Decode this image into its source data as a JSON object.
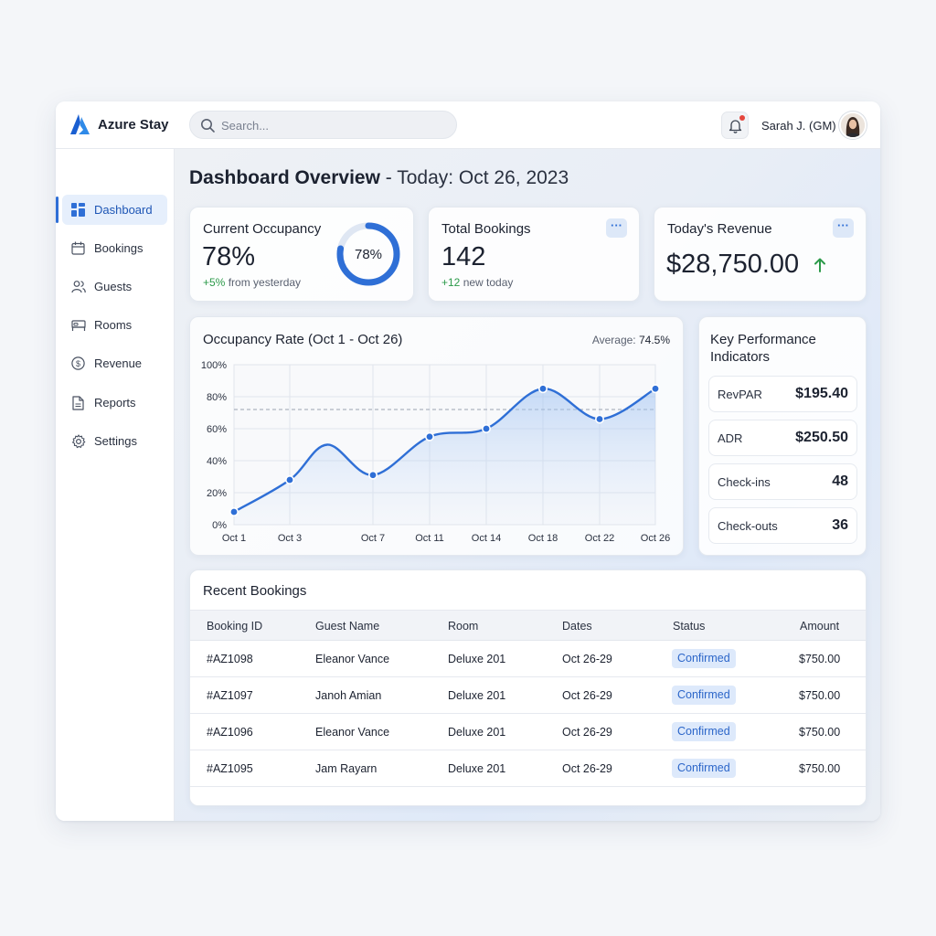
{
  "app": {
    "name": "Azure Stay"
  },
  "search": {
    "placeholder": "Search..."
  },
  "user": {
    "name": "Sarah J. (GM)"
  },
  "sidebar": {
    "items": [
      {
        "label": "Dashboard",
        "icon": "dashboard-icon",
        "active": true
      },
      {
        "label": "Bookings",
        "icon": "calendar-icon"
      },
      {
        "label": "Guests",
        "icon": "users-icon"
      },
      {
        "label": "Rooms",
        "icon": "bed-icon"
      },
      {
        "label": "Revenue",
        "icon": "dollar-icon"
      },
      {
        "label": "Reports",
        "icon": "document-icon"
      },
      {
        "label": "Settings",
        "icon": "gear-icon"
      }
    ]
  },
  "header": {
    "title_bold": "Dashboard Overview",
    "title_rest": " - Today: Oct 26, 2023"
  },
  "stats": {
    "occupancy": {
      "title": "Current Occupancy",
      "value": "78%",
      "change": "+5%",
      "change_rest": " from yesterday",
      "ring_label": "78%",
      "ring_fraction": 0.78
    },
    "bookings": {
      "title": "Total Bookings",
      "value": "142",
      "change": "+12",
      "change_rest": " new today",
      "menu": "···"
    },
    "revenue": {
      "title": "Today's Revenue",
      "value": "$28,750.00",
      "trend_icon": "arrow-up-icon",
      "menu": "···"
    }
  },
  "chart_card": {
    "title": "Occupancy Rate (Oct 1 - Oct 26)",
    "avg_label": "Average:",
    "avg_value": "74.5%"
  },
  "chart_data": {
    "type": "line",
    "x": [
      "Oct 1",
      "Oct 3",
      "Oct 5",
      "Oct 7",
      "Oct 11",
      "Oct 14",
      "Oct 18",
      "Oct 22",
      "Oct 26"
    ],
    "x_tick_labels": [
      "Oct 1",
      "Oct 3",
      "Oct 7",
      "Oct 11",
      "Oct 14",
      "Oct 18",
      "Oct 22",
      "Oct 26"
    ],
    "y_tick_labels": [
      "0%",
      "20%",
      "40%",
      "60%",
      "80%",
      "100%"
    ],
    "series": [
      {
        "values": [
          8,
          28,
          50,
          31,
          55,
          60,
          85,
          66,
          85
        ],
        "markers": [
          true,
          true,
          false,
          true,
          true,
          true,
          true,
          true,
          true
        ]
      }
    ],
    "average_line": 72,
    "ylim": [
      0,
      100
    ],
    "grid": true,
    "color": "#2f6fd6"
  },
  "kpi": {
    "title_line1": "Key Performance",
    "title_line2": "Indicators",
    "items": [
      {
        "label": "RevPAR",
        "value": "$195.40"
      },
      {
        "label": "ADR",
        "value": "$250.50"
      },
      {
        "label": "Check-ins",
        "value": "48"
      },
      {
        "label": "Check-outs",
        "value": "36"
      }
    ]
  },
  "recent": {
    "title": "Recent Bookings",
    "columns": [
      "Booking ID",
      "Guest Name",
      "Room",
      "Dates",
      "Status",
      "Amount"
    ],
    "rows": [
      [
        "#AZ1098",
        "Eleanor Vance",
        "Deluxe 201",
        "Oct 26-29",
        "Confirmed",
        "$750.00"
      ],
      [
        "#AZ1097",
        "Janoh Amian",
        "Deluxe 201",
        "Oct 26-29",
        "Confirmed",
        "$750.00"
      ],
      [
        "#AZ1096",
        "Eleanor Vance",
        "Deluxe 201",
        "Oct 26-29",
        "Confirmed",
        "$750.00"
      ],
      [
        "#AZ1095",
        "Jam Rayarn",
        "Deluxe 201",
        "Oct 26-29",
        "Confirmed",
        "$750.00"
      ]
    ]
  },
  "colors": {
    "accent": "#2f6fd6",
    "positive": "#2c9a4a",
    "notification": "#e5463c"
  }
}
